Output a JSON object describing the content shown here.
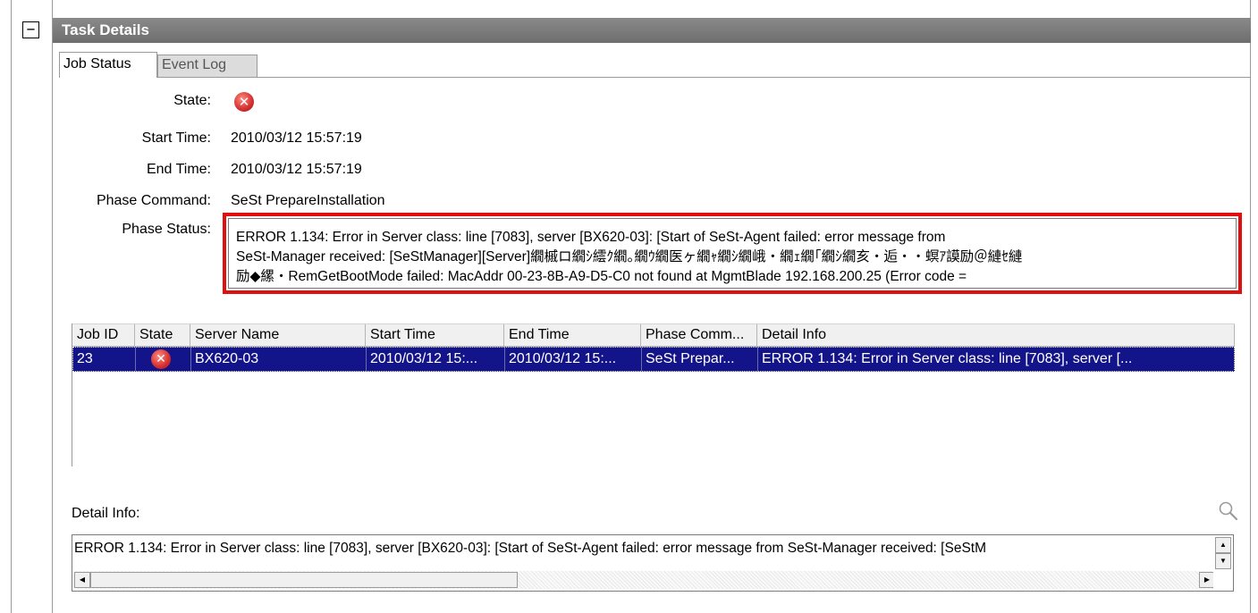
{
  "panel": {
    "collapse_glyph": "−",
    "title": "Task Details"
  },
  "tabs": [
    {
      "label": "Job Status",
      "active": true
    },
    {
      "label": "Event Log",
      "active": false
    }
  ],
  "job_info": {
    "state_label": "State:",
    "state_icon": "error-icon",
    "start_time_label": "Start Time:",
    "start_time": "2010/03/12 15:57:19",
    "end_time_label": "End Time:",
    "end_time": "2010/03/12 15:57:19",
    "phase_command_label": "Phase Command:",
    "phase_command": "SeSt PrepareInstallation",
    "phase_status_label": "Phase Status:",
    "phase_status_lines": [
      "ERROR 1.134: Error in Server class: line [7083], server [BX620-03]: [Start of SeSt-Agent failed: error message from",
      "SeSt-Manager received: [SeStManager][Server]繝槭ロ繝ｼ繧ｸ繝｡繝ｳ繝医ヶ繝ｬ繝ｼ繝峨・繝ｪ繝｢繝ｼ繝亥・逅・・螟ｱ謨励＠縺ｾ縺",
      "励◆縲・RemGetBootMode failed: MacAddr 00-23-8B-A9-D5-C0 not found at MgmtBlade 192.168.200.25 (Error code ="
    ]
  },
  "jobs_table": {
    "columns": [
      "Job ID",
      "State",
      "Server Name",
      "Start Time",
      "End Time",
      "Phase Comm...",
      "Detail Info"
    ],
    "rows": [
      {
        "job_id": "23",
        "state_icon": "error-icon",
        "server_name": "BX620-03",
        "start_time": "2010/03/12 15:...",
        "end_time": "2010/03/12 15:...",
        "phase_command": "SeSt Prepar...",
        "detail_info": "ERROR 1.134: Error in Server class: line [7083], server [..."
      }
    ]
  },
  "detail": {
    "label": "Detail Info:",
    "text": "ERROR 1.134: Error in Server class: line [7083], server [BX620-03]: [Start of SeSt-Agent failed: error message from SeSt-Manager received: [SeStM",
    "search_icon": "magnifier-icon"
  },
  "colors": {
    "title_bar": "#7a7a7a",
    "highlight_border": "#e01010",
    "selected_row": "#14148a",
    "error_red": "#d32f2f"
  }
}
